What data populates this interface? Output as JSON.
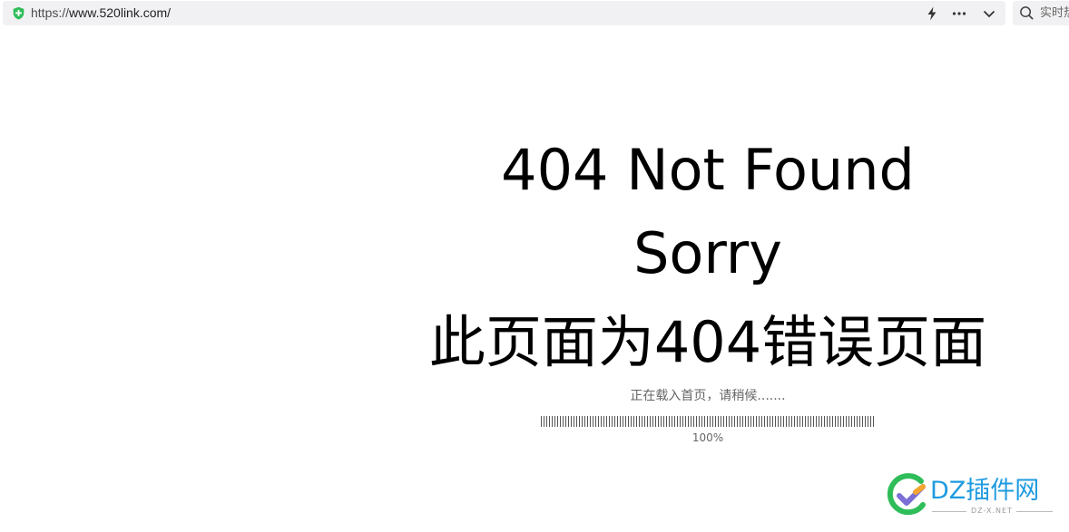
{
  "browser": {
    "url_scheme": "https://",
    "url_host": "www.520link.com/",
    "search_placeholder": "实时热",
    "icons": [
      "shield-icon",
      "lightning-icon",
      "more-icon",
      "chevron-down-icon",
      "search-icon"
    ],
    "accent_color": "#2ebd59"
  },
  "page": {
    "title": "404 Not Found",
    "subtitle": "Sorry",
    "message_cn": "此页面为404错误页面",
    "loading_text": "正在载入首页，请稍候.......",
    "progress_percent": 100,
    "progress_label": "100%"
  },
  "watermark": {
    "brand": "DZ插件网",
    "domain": "DZ-X.NET",
    "colors": [
      "#2ebd59",
      "#1e9be0",
      "#f2a531"
    ]
  }
}
